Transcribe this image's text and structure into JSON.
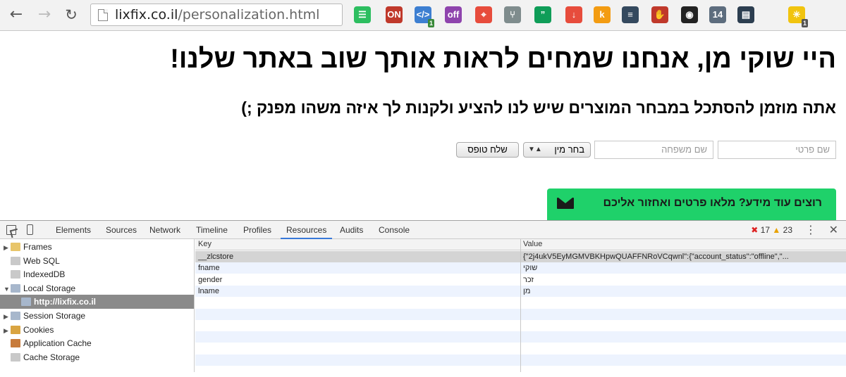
{
  "browser": {
    "url_host": "lixfix.co.il",
    "url_path": "/personalization.html",
    "extensions": [
      {
        "name": "evernote-icon",
        "color": "#2dbe60",
        "label": "☰"
      },
      {
        "name": "adblock-on-icon",
        "color": "#c0392b",
        "label": "ON"
      },
      {
        "name": "html-validator-icon",
        "color": "#3d7fd1",
        "label": "</>"
      },
      {
        "name": "ghostery-icon",
        "color": "#8e44ad",
        "label": "off"
      },
      {
        "name": "red-target-icon",
        "color": "#e74c3c",
        "label": "⌖"
      },
      {
        "name": "y-icon",
        "color": "#7f8c8d",
        "label": "⑂"
      },
      {
        "name": "hangouts-icon",
        "color": "#0f9d58",
        "label": "”"
      },
      {
        "name": "download-icon",
        "color": "#e74c3c",
        "label": "↓"
      },
      {
        "name": "k-icon",
        "color": "#f39c12",
        "label": "k"
      },
      {
        "name": "layers-icon",
        "color": "#34495e",
        "label": "≡"
      },
      {
        "name": "stop-icon",
        "color": "#c0392b",
        "label": "✋"
      },
      {
        "name": "eye-icon",
        "color": "#222222",
        "label": "◉"
      },
      {
        "name": "calendar-icon",
        "color": "#5d6d7e",
        "label": "14"
      },
      {
        "name": "chart-icon",
        "color": "#2c3e50",
        "label": "▤"
      },
      {
        "name": "puzzle-icon",
        "color": "#f1c40f",
        "label": "✳"
      }
    ],
    "badges": {
      "ext2": "1",
      "ext15": "1"
    }
  },
  "page": {
    "greeting": "היי שוקי מן, אנחנו שמחים לראות אותך שוב באתר שלנו!",
    "subtitle": "אתה מוזמן להסתכל במבחר המוצרים שיש לנו להציע ולקנות לך איזה משהו מפנק ;)",
    "fname_placeholder": "שם פרטי",
    "lname_placeholder": "שם משפחה",
    "gender_label": "בחר מין",
    "submit_label": "שלח טופס",
    "cta_text": "רוצים עוד מידע? מלאו פרטים ואחזור אליכם"
  },
  "devtools": {
    "tabs": [
      "Elements",
      "Sources",
      "Network",
      "Timeline",
      "Profiles",
      "Resources",
      "Audits",
      "Console"
    ],
    "active_tab": "Resources",
    "error_count": "17",
    "warning_count": "23",
    "tree": [
      {
        "label": "Frames",
        "expandable": true,
        "expanded": false,
        "icon": "folder-icon"
      },
      {
        "label": "Web SQL",
        "expandable": false,
        "icon": "database-icon"
      },
      {
        "label": "IndexedDB",
        "expandable": false,
        "icon": "database-icon"
      },
      {
        "label": "Local Storage",
        "expandable": true,
        "expanded": true,
        "icon": "storage-grid-icon"
      },
      {
        "label": "http://lixfix.co.il",
        "selected": true,
        "icon": "storage-grid-icon"
      },
      {
        "label": "Session Storage",
        "expandable": true,
        "expanded": false,
        "icon": "storage-grid-icon"
      },
      {
        "label": "Cookies",
        "expandable": true,
        "expanded": false,
        "icon": "cookie-icon"
      },
      {
        "label": "Application Cache",
        "expandable": false,
        "icon": "app-cache-icon"
      },
      {
        "label": "Cache Storage",
        "expandable": false,
        "icon": "database-icon"
      }
    ],
    "table": {
      "headers": [
        "Key",
        "Value"
      ],
      "rows": [
        {
          "key": "__zlcstore",
          "value": "{\"2j4ukV5EyMGMVBKHpwQUAFFNRoVCqwnl\":{\"account_status\":\"offline\",\"..."
        },
        {
          "key": "fname",
          "value": "שוקי"
        },
        {
          "key": "gender",
          "value": "זכר"
        },
        {
          "key": "lname",
          "value": "מן"
        }
      ]
    }
  }
}
